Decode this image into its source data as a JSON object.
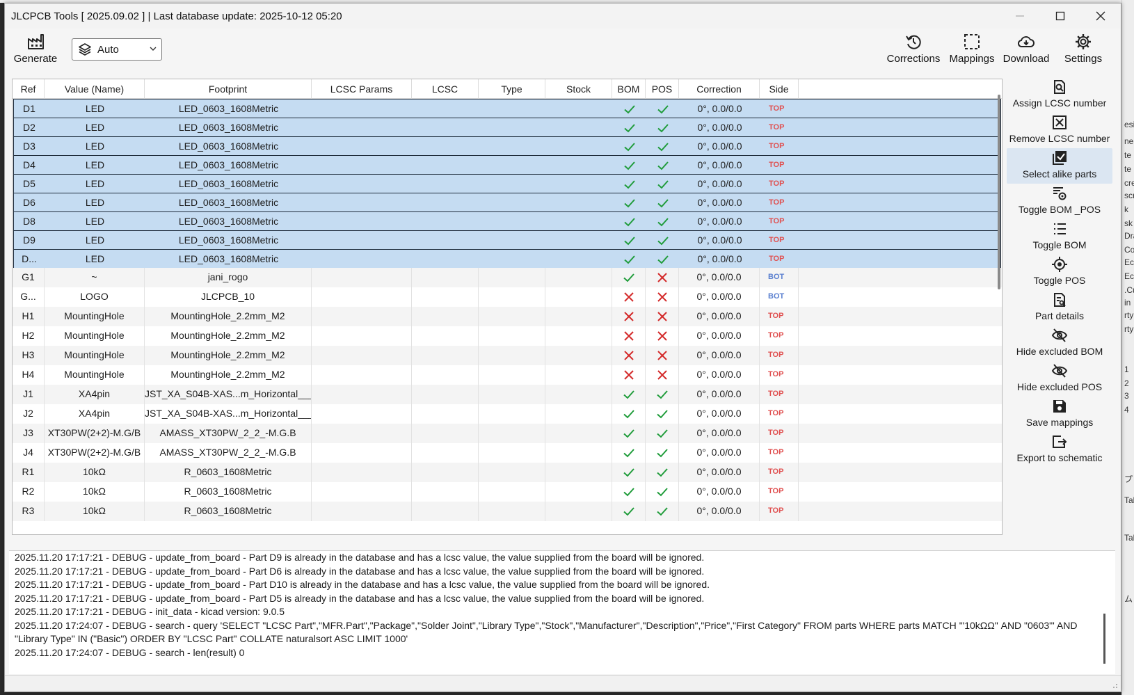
{
  "window": {
    "title": "JLCPCB Tools [ 2025.09.02 ] | Last database update: 2025-10-12 05:20"
  },
  "toolbar": {
    "generate_label": "Generate",
    "layer_select_value": "Auto",
    "corrections_label": "Corrections",
    "mappings_label": "Mappings",
    "download_label": "Download",
    "settings_label": "Settings"
  },
  "table": {
    "columns": [
      "Ref",
      "Value (Name)",
      "Footprint",
      "LCSC Params",
      "LCSC",
      "Type",
      "Stock",
      "BOM",
      "POS",
      "Correction",
      "Side"
    ],
    "rows": [
      {
        "ref": "D1",
        "value": "LED",
        "footprint": "LED_0603_1608Metric",
        "lcsc_params": "",
        "lcsc": "",
        "type": "",
        "stock": "",
        "bom": true,
        "pos": true,
        "correction": "0°, 0.0/0.0",
        "side": "TOP",
        "selected": true
      },
      {
        "ref": "D2",
        "value": "LED",
        "footprint": "LED_0603_1608Metric",
        "lcsc_params": "",
        "lcsc": "",
        "type": "",
        "stock": "",
        "bom": true,
        "pos": true,
        "correction": "0°, 0.0/0.0",
        "side": "TOP",
        "selected": true
      },
      {
        "ref": "D3",
        "value": "LED",
        "footprint": "LED_0603_1608Metric",
        "lcsc_params": "",
        "lcsc": "",
        "type": "",
        "stock": "",
        "bom": true,
        "pos": true,
        "correction": "0°, 0.0/0.0",
        "side": "TOP",
        "selected": true
      },
      {
        "ref": "D4",
        "value": "LED",
        "footprint": "LED_0603_1608Metric",
        "lcsc_params": "",
        "lcsc": "",
        "type": "",
        "stock": "",
        "bom": true,
        "pos": true,
        "correction": "0°, 0.0/0.0",
        "side": "TOP",
        "selected": true
      },
      {
        "ref": "D5",
        "value": "LED",
        "footprint": "LED_0603_1608Metric",
        "lcsc_params": "",
        "lcsc": "",
        "type": "",
        "stock": "",
        "bom": true,
        "pos": true,
        "correction": "0°, 0.0/0.0",
        "side": "TOP",
        "selected": true
      },
      {
        "ref": "D6",
        "value": "LED",
        "footprint": "LED_0603_1608Metric",
        "lcsc_params": "",
        "lcsc": "",
        "type": "",
        "stock": "",
        "bom": true,
        "pos": true,
        "correction": "0°, 0.0/0.0",
        "side": "TOP",
        "selected": true
      },
      {
        "ref": "D8",
        "value": "LED",
        "footprint": "LED_0603_1608Metric",
        "lcsc_params": "",
        "lcsc": "",
        "type": "",
        "stock": "",
        "bom": true,
        "pos": true,
        "correction": "0°, 0.0/0.0",
        "side": "TOP",
        "selected": true
      },
      {
        "ref": "D9",
        "value": "LED",
        "footprint": "LED_0603_1608Metric",
        "lcsc_params": "",
        "lcsc": "",
        "type": "",
        "stock": "",
        "bom": true,
        "pos": true,
        "correction": "0°, 0.0/0.0",
        "side": "TOP",
        "selected": true
      },
      {
        "ref": "D...",
        "value": "LED",
        "footprint": "LED_0603_1608Metric",
        "lcsc_params": "",
        "lcsc": "",
        "type": "",
        "stock": "",
        "bom": true,
        "pos": true,
        "correction": "0°, 0.0/0.0",
        "side": "TOP",
        "selected": true
      },
      {
        "ref": "G1",
        "value": "~",
        "footprint": "jani_rogo",
        "lcsc_params": "",
        "lcsc": "",
        "type": "",
        "stock": "",
        "bom": true,
        "pos": false,
        "correction": "0°, 0.0/0.0",
        "side": "BOT",
        "selected": false
      },
      {
        "ref": "G...",
        "value": "LOGO",
        "footprint": "JLCPCB_10",
        "lcsc_params": "",
        "lcsc": "",
        "type": "",
        "stock": "",
        "bom": false,
        "pos": false,
        "correction": "0°, 0.0/0.0",
        "side": "BOT",
        "selected": false
      },
      {
        "ref": "H1",
        "value": "MountingHole",
        "footprint": "MountingHole_2.2mm_M2",
        "lcsc_params": "",
        "lcsc": "",
        "type": "",
        "stock": "",
        "bom": false,
        "pos": false,
        "correction": "0°, 0.0/0.0",
        "side": "TOP",
        "selected": false
      },
      {
        "ref": "H2",
        "value": "MountingHole",
        "footprint": "MountingHole_2.2mm_M2",
        "lcsc_params": "",
        "lcsc": "",
        "type": "",
        "stock": "",
        "bom": false,
        "pos": false,
        "correction": "0°, 0.0/0.0",
        "side": "TOP",
        "selected": false
      },
      {
        "ref": "H3",
        "value": "MountingHole",
        "footprint": "MountingHole_2.2mm_M2",
        "lcsc_params": "",
        "lcsc": "",
        "type": "",
        "stock": "",
        "bom": false,
        "pos": false,
        "correction": "0°, 0.0/0.0",
        "side": "TOP",
        "selected": false
      },
      {
        "ref": "H4",
        "value": "MountingHole",
        "footprint": "MountingHole_2.2mm_M2",
        "lcsc_params": "",
        "lcsc": "",
        "type": "",
        "stock": "",
        "bom": false,
        "pos": false,
        "correction": "0°, 0.0/0.0",
        "side": "TOP",
        "selected": false
      },
      {
        "ref": "J1",
        "value": "XA4pin",
        "footprint": "JST_XA_S04B-XAS...m_Horizontal___",
        "lcsc_params": "",
        "lcsc": "",
        "type": "",
        "stock": "",
        "bom": true,
        "pos": true,
        "correction": "0°, 0.0/0.0",
        "side": "TOP",
        "selected": false
      },
      {
        "ref": "J2",
        "value": "XA4pin",
        "footprint": "JST_XA_S04B-XAS...m_Horizontal___",
        "lcsc_params": "",
        "lcsc": "",
        "type": "",
        "stock": "",
        "bom": true,
        "pos": true,
        "correction": "0°, 0.0/0.0",
        "side": "TOP",
        "selected": false
      },
      {
        "ref": "J3",
        "value": "XT30PW(2+2)-M.G/B",
        "footprint": "AMASS_XT30PW_2_2_-M.G.B",
        "lcsc_params": "",
        "lcsc": "",
        "type": "",
        "stock": "",
        "bom": true,
        "pos": true,
        "correction": "0°, 0.0/0.0",
        "side": "TOP",
        "selected": false
      },
      {
        "ref": "J4",
        "value": "XT30PW(2+2)-M.G/B",
        "footprint": "AMASS_XT30PW_2_2_-M.G.B",
        "lcsc_params": "",
        "lcsc": "",
        "type": "",
        "stock": "",
        "bom": true,
        "pos": true,
        "correction": "0°, 0.0/0.0",
        "side": "TOP",
        "selected": false
      },
      {
        "ref": "R1",
        "value": "10kΩ",
        "footprint": "R_0603_1608Metric",
        "lcsc_params": "",
        "lcsc": "",
        "type": "",
        "stock": "",
        "bom": true,
        "pos": true,
        "correction": "0°, 0.0/0.0",
        "side": "TOP",
        "selected": false
      },
      {
        "ref": "R2",
        "value": "10kΩ",
        "footprint": "R_0603_1608Metric",
        "lcsc_params": "",
        "lcsc": "",
        "type": "",
        "stock": "",
        "bom": true,
        "pos": true,
        "correction": "0°, 0.0/0.0",
        "side": "TOP",
        "selected": false
      },
      {
        "ref": "R3",
        "value": "10kΩ",
        "footprint": "R_0603_1608Metric",
        "lcsc_params": "",
        "lcsc": "",
        "type": "",
        "stock": "",
        "bom": true,
        "pos": true,
        "correction": "0°, 0.0/0.0",
        "side": "TOP",
        "selected": false
      }
    ]
  },
  "actions": [
    {
      "label": "Assign LCSC number",
      "icon": "search-doc-icon"
    },
    {
      "label": "Remove LCSC number",
      "icon": "x-box-icon"
    },
    {
      "label": "Select alike parts",
      "icon": "checkbox-icon",
      "highlighted": true
    },
    {
      "label": "Toggle BOM _POS",
      "icon": "list-target-icon"
    },
    {
      "label": "Toggle BOM",
      "icon": "list-icon"
    },
    {
      "label": "Toggle POS",
      "icon": "target-icon"
    },
    {
      "label": "Part details",
      "icon": "doc-search-icon"
    },
    {
      "label": "Hide excluded BOM",
      "icon": "eye-off-icon"
    },
    {
      "label": "Hide excluded POS",
      "icon": "eye-off-icon"
    },
    {
      "label": "Save mappings",
      "icon": "save-icon"
    },
    {
      "label": "Export to schematic",
      "icon": "export-icon"
    }
  ],
  "log": [
    "2025.11.20 17:17:21 - DEBUG - update_from_board -  Part D9 is already in the database and has a lcsc value, the value supplied from the board will be ignored.",
    "2025.11.20 17:17:21 - DEBUG - update_from_board -  Part D6 is already in the database and has a lcsc value, the value supplied from the board will be ignored.",
    "2025.11.20 17:17:21 - DEBUG - update_from_board -  Part D10 is already in the database and has a lcsc value, the value supplied from the board will be ignored.",
    "2025.11.20 17:17:21 - DEBUG - update_from_board -  Part D5 is already in the database and has a lcsc value, the value supplied from the board will be ignored.",
    "2025.11.20 17:17:21 - DEBUG - init_data -  kicad version: 9.0.5",
    "2025.11.20 17:24:07 - DEBUG - search -  query 'SELECT \"LCSC Part\",\"MFR.Part\",\"Package\",\"Solder Joint\",\"Library Type\",\"Stock\",\"Manufacturer\",\"Description\",\"Price\",\"First Category\" FROM parts WHERE parts MATCH '\"10kΩΩ\" AND \"0603\"' AND \"Library Type\" IN (\"Basic\") ORDER BY \"LCSC Part\" COLLATE naturalsort ASC LIMIT 1000'",
    "2025.11.20 17:24:07 - DEBUG - search -  len(result) 0"
  ],
  "background_fragments": [
    "esi",
    "nes",
    "te",
    "te",
    "cre",
    "scr",
    "k",
    "sk",
    "Dra",
    "Cor",
    "Ecc",
    "Ecc",
    ".Cu",
    "in",
    "rty",
    "rty",
    "1",
    "2",
    "3",
    "4",
    "プ",
    "Tab",
    "Tal",
    "ム"
  ],
  "colors": {
    "selection": "#c5dcf2",
    "check": "#1f9c3a",
    "cross": "#d42a2a",
    "side_top": "#e05050",
    "side_bot": "#5a7fcf"
  }
}
